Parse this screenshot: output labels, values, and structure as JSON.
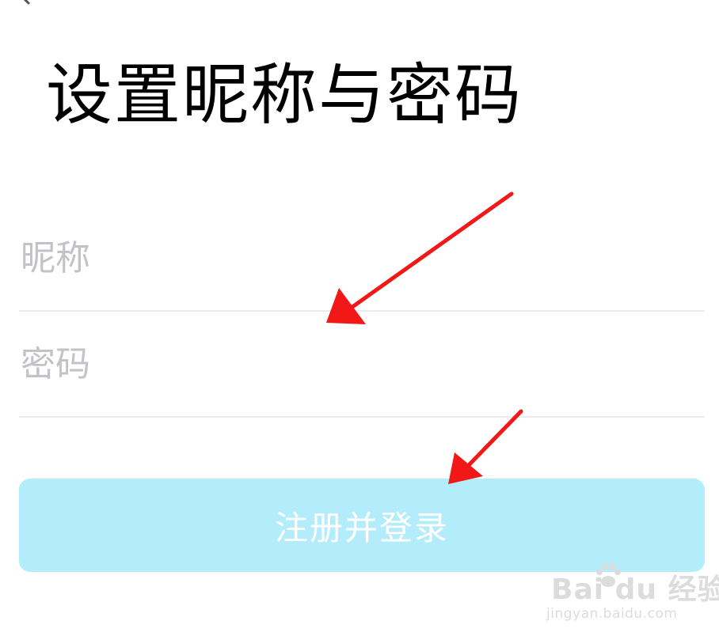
{
  "header": {
    "title": "设置昵称与密码"
  },
  "form": {
    "nickname_placeholder": "昵称",
    "password_placeholder": "密码",
    "submit_label": "注册并登录"
  },
  "watermark": {
    "logo_text": "Bai du 经验",
    "url": "jingyan.baidu.com"
  },
  "colors": {
    "button_bg": "#b3ecfa",
    "placeholder": "#c2c2c8",
    "divider": "#ececec",
    "annotation_arrow": "#f21818"
  },
  "icons": {
    "back": "chevron-left-icon"
  }
}
